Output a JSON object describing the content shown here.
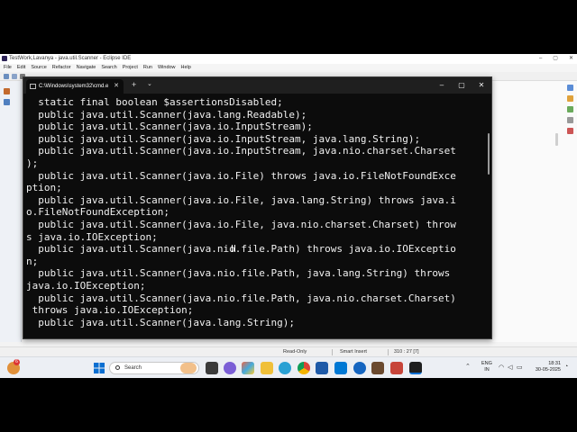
{
  "eclipse": {
    "title": "TestWork,Lavanya - java.util.Scanner - Eclipse IDE",
    "menu": [
      "File",
      "Edit",
      "Source",
      "Refactor",
      "Navigate",
      "Search",
      "Project",
      "Run",
      "Window",
      "Help"
    ],
    "status": {
      "mode": "Read-Only",
      "insert": "Smart Insert",
      "position": "310 : 27 [7]"
    }
  },
  "cmd": {
    "tab_title": "C:\\Windows\\system32\\cmd.e",
    "lines": [
      "  static final boolean $assertionsDisabled;",
      "  public java.util.Scanner(java.lang.Readable);",
      "  public java.util.Scanner(java.io.InputStream);",
      "  public java.util.Scanner(java.io.InputStream, java.lang.String);",
      "  public java.util.Scanner(java.io.InputStream, java.nio.charset.Charset",
      ");",
      "  public java.util.Scanner(java.io.File) throws java.io.FileNotFoundExce",
      "ption;",
      "  public java.util.Scanner(java.io.File, java.lang.String) throws java.i",
      "o.FileNotFoundException;",
      "  public java.util.Scanner(java.io.File, java.nio.charset.Charset) throw",
      "s java.io.IOException;",
      "  public java.util.Scanner(java.nio.file.Path) throws java.io.IOExceptio",
      "n;",
      "  public java.util.Scanner(java.nio.file.Path, java.lang.String) throws",
      "java.io.IOException;",
      "  public java.util.Scanner(java.nio.file.Path, java.nio.charset.Charset)",
      " throws java.io.IOException;",
      "  public java.util.Scanner(java.lang.String);"
    ]
  },
  "taskbar": {
    "search_label": "Search",
    "notification_count": "6",
    "lang_line1": "ENG",
    "lang_line2": "IN",
    "time": "18:31",
    "date": "30-05-2025"
  },
  "icons": {
    "start": "windows-start-icon",
    "search": "search-icon",
    "terminal": "terminal-icon"
  },
  "colors": {
    "cmd_bg": "#0c0c0c",
    "cmd_text": "#f0f0f0",
    "start_blue": "#0a6ed1"
  }
}
